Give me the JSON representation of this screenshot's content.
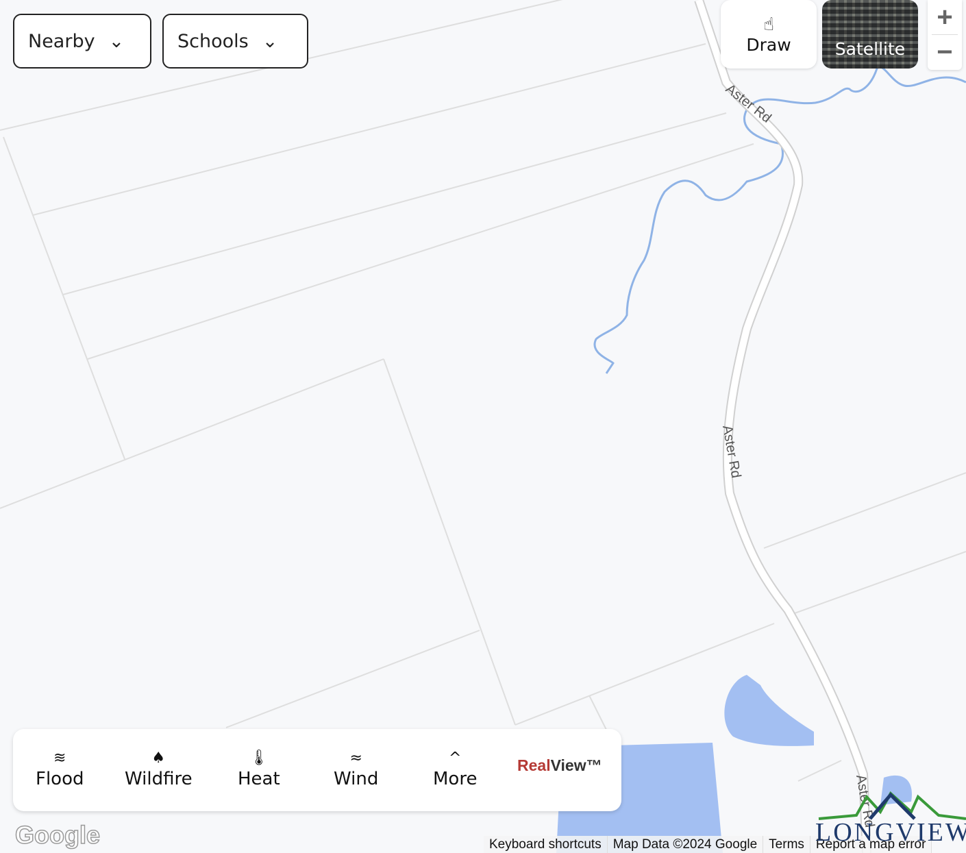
{
  "filters": {
    "nearby": "Nearby",
    "schools": "Schools"
  },
  "map_controls": {
    "draw": "Draw",
    "satellite": "Satellite",
    "zoom_in": "+",
    "zoom_out": "−"
  },
  "road_labels": [
    "Aster Rd",
    "Aster Rd",
    "Aster Rd"
  ],
  "risk_bar": {
    "items": [
      {
        "label": "Flood",
        "icon": "flood-icon"
      },
      {
        "label": "Wildfire",
        "icon": "wildfire-icon"
      },
      {
        "label": "Heat",
        "icon": "heat-icon"
      },
      {
        "label": "Wind",
        "icon": "wind-icon"
      },
      {
        "label": "More",
        "icon": "chevron-up-icon"
      }
    ],
    "brand_red": "Real",
    "brand_dark": "View™"
  },
  "google_logo": "Google",
  "attribution": {
    "shortcuts": "Keyboard shortcuts",
    "map_data": "Map Data ©2024 Google",
    "terms": "Terms",
    "report": "Report a map error"
  },
  "watermark": "LONGVIEW",
  "colors": {
    "water": "#a3bff2",
    "stream": "#8fb3e6",
    "parcel": "#dcdcdc",
    "road": "#ffffff",
    "brand_red": "#b53a35"
  }
}
